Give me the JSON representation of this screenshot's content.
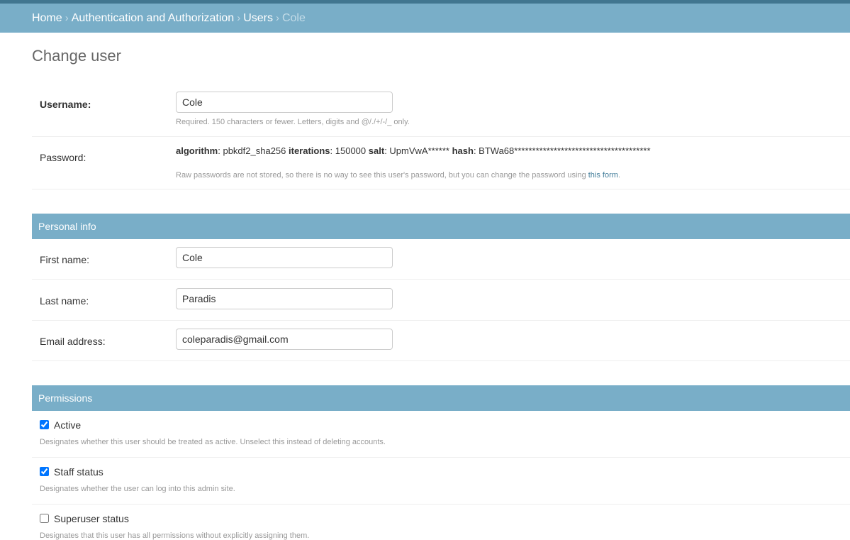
{
  "breadcrumbs": {
    "home": "Home",
    "app": "Authentication and Authorization",
    "model": "Users",
    "current": "Cole",
    "separator": "›"
  },
  "page_title": "Change user",
  "username": {
    "label": "Username:",
    "value": "Cole",
    "help": "Required. 150 characters or fewer. Letters, digits and @/./+/-/_ only."
  },
  "password": {
    "label": "Password:",
    "algorithm_label": "algorithm",
    "algorithm_value": "pbkdf2_sha256",
    "iterations_label": "iterations",
    "iterations_value": "150000",
    "salt_label": "salt",
    "salt_value": "UpmVwA******",
    "hash_label": "hash",
    "hash_value": "BTWa68**************************************",
    "help_prefix": "Raw passwords are not stored, so there is no way to see this user's password, but you can change the password using",
    "help_link": "this form",
    "help_suffix": "."
  },
  "personal_info": {
    "title": "Personal info",
    "first_name": {
      "label": "First name:",
      "value": "Cole"
    },
    "last_name": {
      "label": "Last name:",
      "value": "Paradis"
    },
    "email": {
      "label": "Email address:",
      "value": "coleparadis@gmail.com"
    }
  },
  "permissions": {
    "title": "Permissions",
    "active": {
      "label": "Active",
      "checked": true,
      "help": "Designates whether this user should be treated as active. Unselect this instead of deleting accounts."
    },
    "staff": {
      "label": "Staff status",
      "checked": true,
      "help": "Designates whether the user can log into this admin site."
    },
    "superuser": {
      "label": "Superuser status",
      "checked": false,
      "help": "Designates that this user has all permissions without explicitly assigning them."
    }
  },
  "colors": {
    "header": "#79aec8",
    "topbar": "#417690",
    "link": "#447e9b"
  }
}
